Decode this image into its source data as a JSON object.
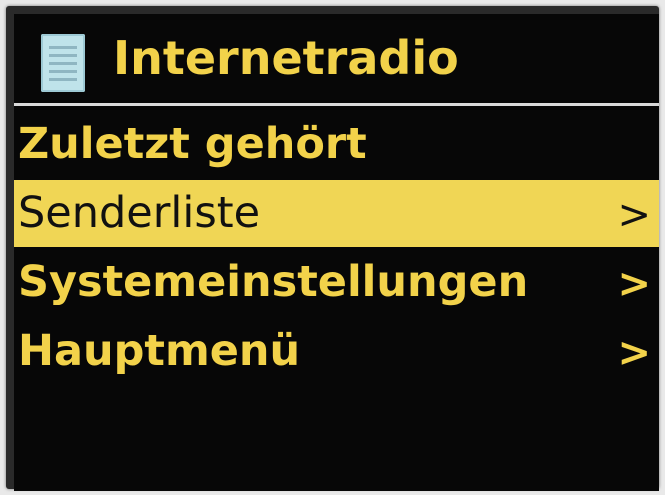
{
  "colors": {
    "screen_background": "#070707",
    "text": "#f2d24a",
    "highlight": "#f0d655",
    "highlight_text": "#111111",
    "separator": "#d9d9d9",
    "icon": "#bfe3ea"
  },
  "header": {
    "icon": "list-document-icon",
    "title": "Internetradio"
  },
  "menu": {
    "selected_index": 1,
    "items": [
      {
        "label": "Zuletzt gehört",
        "arrow": ""
      },
      {
        "label": "Senderliste",
        "arrow": ">"
      },
      {
        "label": "Systemeinstellungen",
        "arrow": ">"
      },
      {
        "label": "Hauptmenü",
        "arrow": ">"
      }
    ]
  }
}
